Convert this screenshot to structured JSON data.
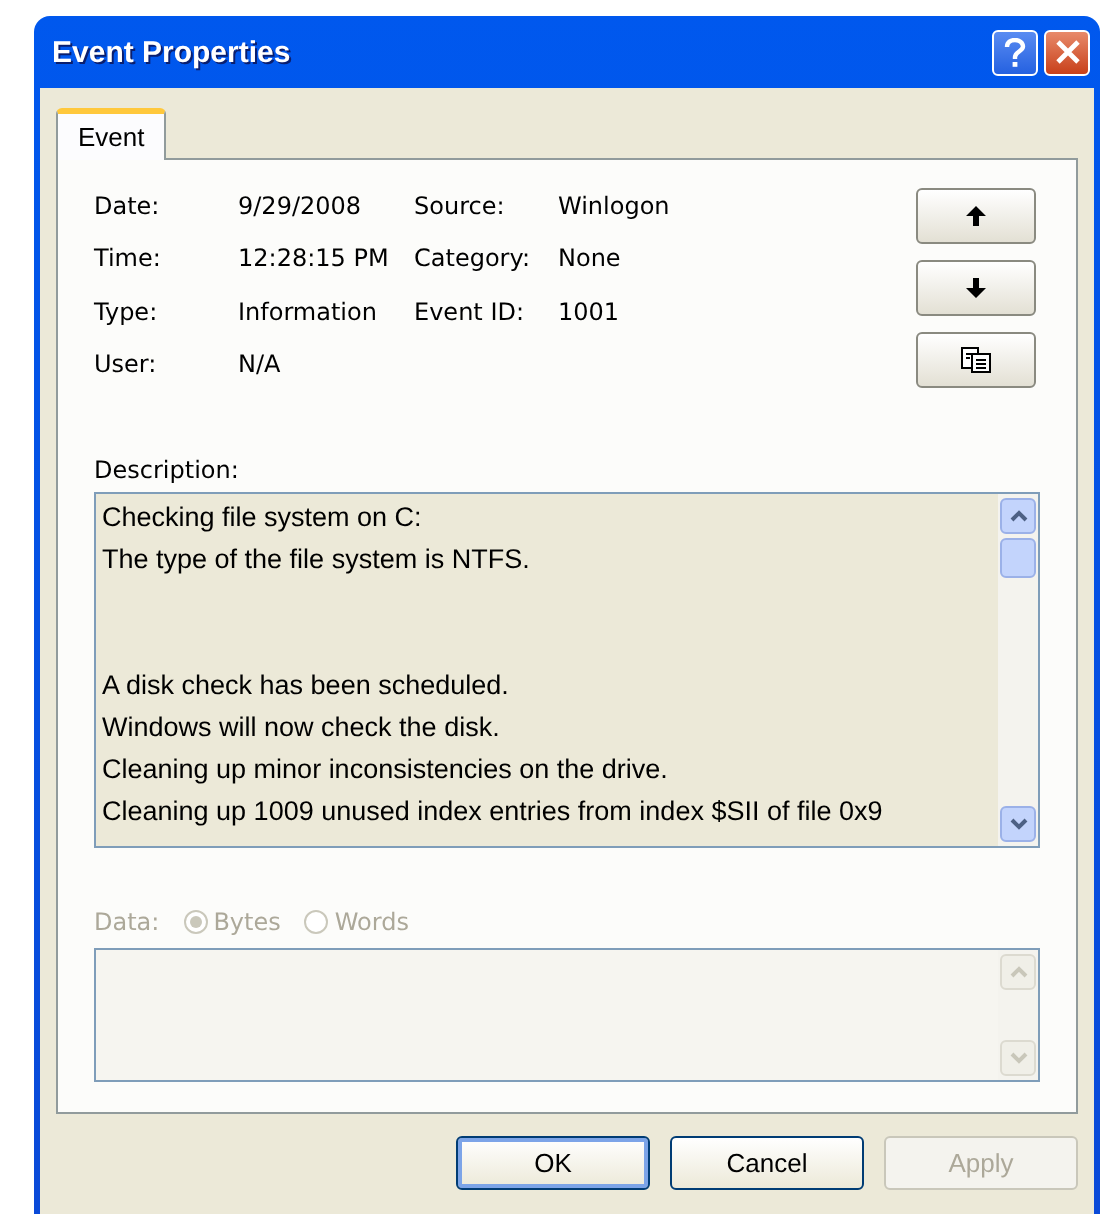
{
  "window": {
    "title": "Event Properties"
  },
  "tabs": [
    {
      "label": "Event",
      "selected": true
    }
  ],
  "fields": [
    {
      "label": "Date:",
      "value": "9/29/2008",
      "label2": "Source:",
      "value2": "Winlogon"
    },
    {
      "label": "Time:",
      "value": "12:28:15 PM",
      "label2": "Category:",
      "value2": "None"
    },
    {
      "label": "Type:",
      "value": "Information",
      "label2": "Event ID:",
      "value2": "1001"
    },
    {
      "label": "User:",
      "value": "N/A"
    }
  ],
  "description": {
    "label": "Description:",
    "text": "Checking file system on C:\nThe type of the file system is NTFS.\n\n\nA disk check has been scheduled.\nWindows will now check the disk.\nCleaning up minor inconsistencies on the drive.\nCleaning up 1009 unused index entries from index $SII of file 0x9"
  },
  "data": {
    "label": "Data:",
    "disabled": true,
    "options": [
      {
        "label": "Bytes",
        "selected": true
      },
      {
        "label": "Words",
        "selected": false
      }
    ]
  },
  "buttons": [
    {
      "label": "OK",
      "disabled": false,
      "default": true
    },
    {
      "label": "Cancel",
      "disabled": false,
      "default": false
    },
    {
      "label": "Apply",
      "disabled": true,
      "default": false
    }
  ]
}
